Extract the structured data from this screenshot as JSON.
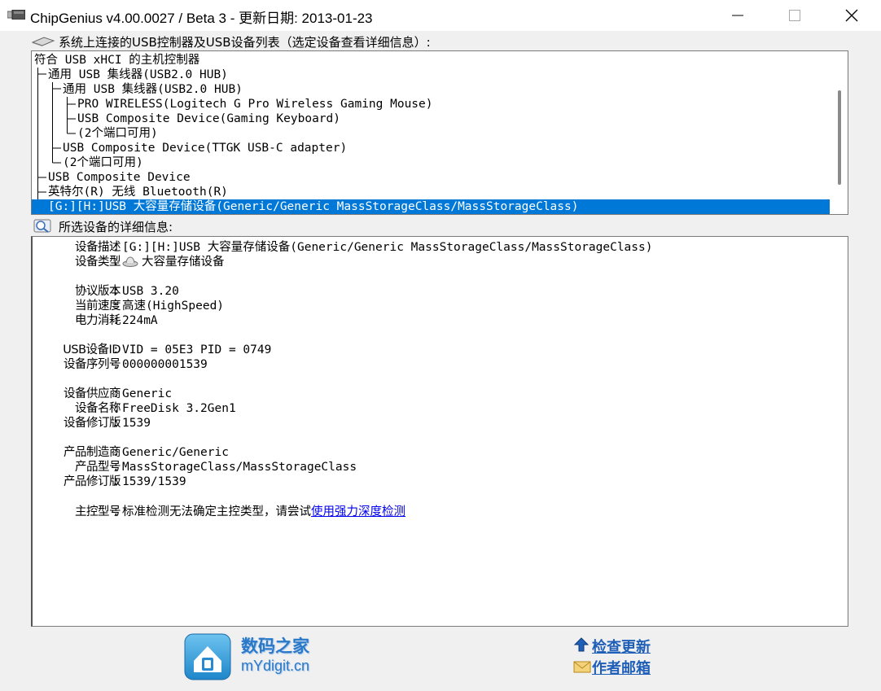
{
  "window": {
    "title": "ChipGenius v4.00.0027 / Beta 3 - 更新日期: 2013-01-23"
  },
  "device_list": {
    "label": "系统上连接的USB控制器及USB设备列表（选定设备查看详细信息）:",
    "items": [
      "符合 USB xHCI 的主机控制器",
      "通用 USB 集线器(USB2.0 HUB)",
      "通用 USB 集线器(USB2.0 HUB)",
      "PRO WIRELESS(Logitech G Pro Wireless Gaming Mouse)",
      "USB Composite Device(Gaming Keyboard)",
      "(2个端口可用)",
      "USB Composite Device(TTGK USB-C adapter)",
      "(2个端口可用)",
      "USB Composite Device",
      "英特尔(R) 无线 Bluetooth(R)",
      "[G:][H:]USB 大容量存储设备(Generic/Generic MassStorageClass/MassStorageClass)"
    ]
  },
  "details": {
    "label": "所选设备的详细信息:",
    "rows": [
      {
        "label": "设备描述",
        "value": "[G:][H:]USB 大容量存储设备(Generic/Generic MassStorageClass/MassStorageClass)"
      },
      {
        "label": "设备类型",
        "value": "大容量存储设备"
      },
      {
        "label": "协议版本",
        "value": "USB 3.20"
      },
      {
        "label": "当前速度",
        "value": "高速(HighSpeed)"
      },
      {
        "label": "电力消耗",
        "value": "224mA"
      },
      {
        "label": "USB设备ID",
        "value": "VID = 05E3 PID = 0749"
      },
      {
        "label": "设备序列号",
        "value": "000000001539"
      },
      {
        "label": "设备供应商",
        "value": "Generic"
      },
      {
        "label": "设备名称",
        "value": "FreeDisk 3.2Gen1"
      },
      {
        "label": "设备修订版",
        "value": "1539"
      },
      {
        "label": "产品制造商",
        "value": "Generic/Generic"
      },
      {
        "label": "产品型号",
        "value": "MassStorageClass/MassStorageClass"
      },
      {
        "label": "产品修订版",
        "value": "1539/1539"
      },
      {
        "label": "主控型号",
        "value": "标准检测无法确定主控类型，请尝试",
        "link": "使用强力深度检测"
      }
    ]
  },
  "footer": {
    "brand_cn": "数码之家",
    "brand_en": "mYdigit.cn",
    "check_update": "检查更新",
    "author_mail": "作者邮箱"
  },
  "colors": {
    "selection": "#0078d7",
    "link": "#0000ee",
    "brand": "#2a78c8"
  }
}
